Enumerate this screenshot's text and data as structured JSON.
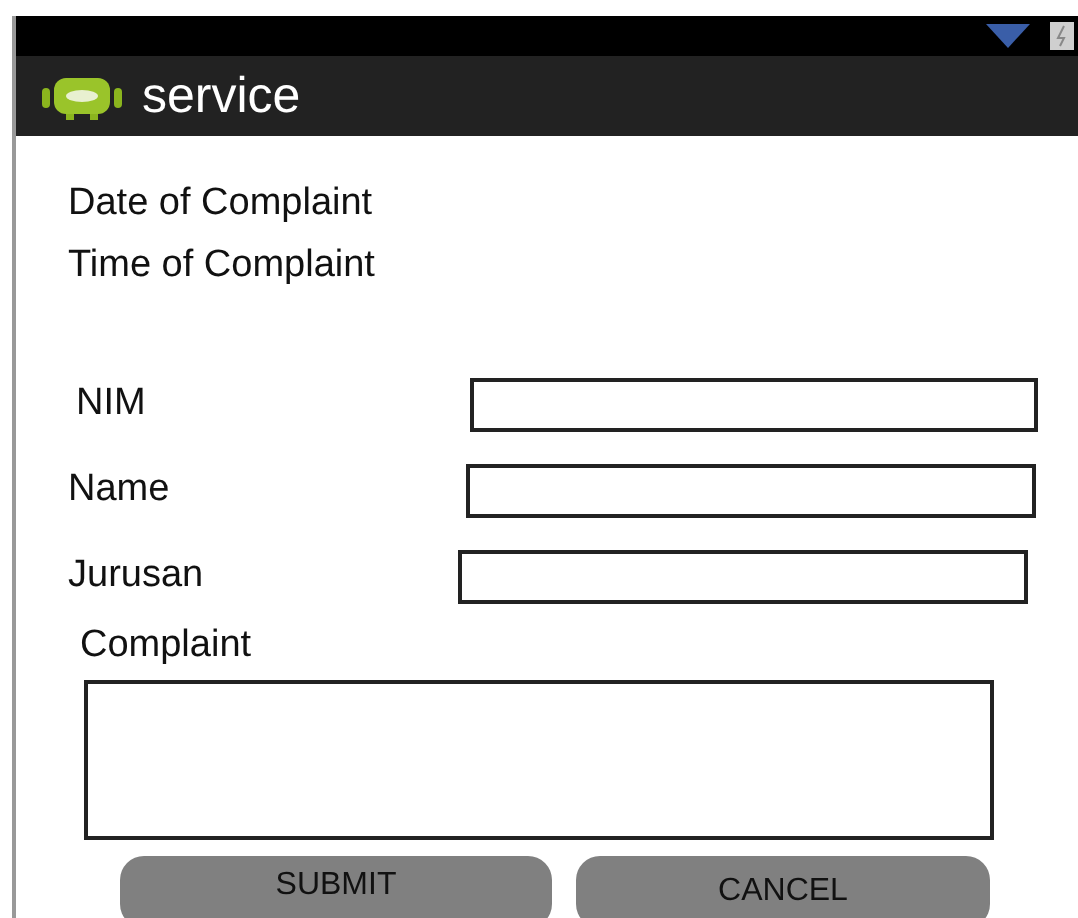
{
  "window": {
    "title": "service"
  },
  "info": [
    "Date of Complaint",
    "Time of Complaint"
  ],
  "fields": [
    {
      "label": "NIM"
    },
    {
      "label": "Name"
    },
    {
      "label": "Jurusan"
    }
  ],
  "complaint": {
    "label": "Complaint"
  },
  "buttons": [
    "SUBMIT",
    "CANCEL"
  ]
}
